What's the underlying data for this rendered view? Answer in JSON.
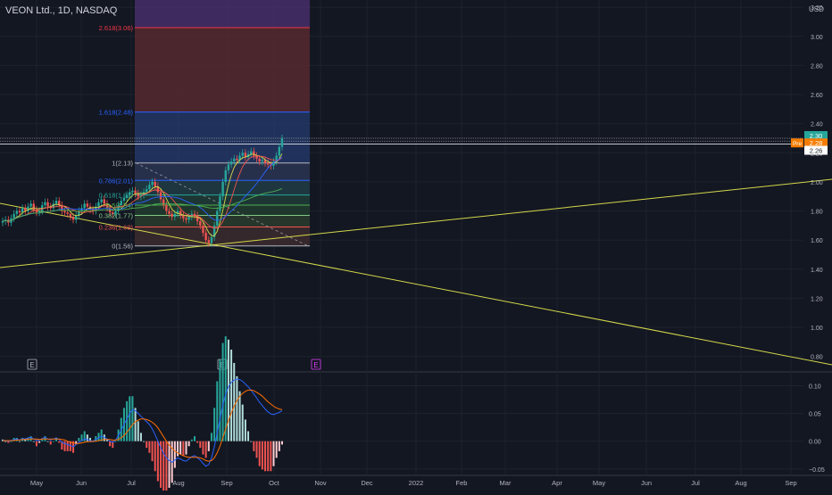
{
  "header": {
    "symbol_title": "VEON Ltd., 1D, NASDAQ",
    "currency": "USD"
  },
  "colors": {
    "background": "#131722",
    "grid": "#1e222d",
    "up": "#26a69a",
    "down": "#ef5350",
    "trendline": "#d4d84a",
    "macd": "#2962ff",
    "signal": "#ff6d00",
    "fib_top_zone": "#4a2f6e",
    "fib_red_zone": "#5a2a30",
    "fib_blue_zone": "#243a6a",
    "pre_badge": "#f57c00"
  },
  "price_axis": {
    "labels": [
      "3.20",
      "3.00",
      "2.80",
      "2.60",
      "2.40",
      "2.20",
      "2.00",
      "1.80",
      "1.60",
      "1.40",
      "1.20",
      "1.00",
      "0.80"
    ],
    "badges": [
      {
        "text": "2.30",
        "color": "#26a69a",
        "text_color": "#ffffff"
      },
      {
        "text": "2.28",
        "color": "#f57c00",
        "text_color": "#ffffff",
        "tag": "Pre"
      },
      {
        "text": "2.26",
        "color": "#ffffff",
        "text_color": "#131722"
      }
    ]
  },
  "macd_axis": {
    "labels": [
      "0.10",
      "0.05",
      "0.00",
      "−0.05"
    ]
  },
  "time_axis": {
    "labels": [
      "May",
      "Jun",
      "Jul",
      "Aug",
      "Sep",
      "Oct",
      "Nov",
      "Dec",
      "2022",
      "Feb",
      "Mar",
      "Apr",
      "May",
      "Jun",
      "Jul",
      "Aug",
      "Sep"
    ]
  },
  "fib_levels": [
    {
      "label": "2.618(3.06)",
      "price": 3.06,
      "color": "#f23645"
    },
    {
      "label": "1.618(2.48)",
      "price": 2.48,
      "color": "#2962ff"
    },
    {
      "label": "1(2.13)",
      "price": 2.13,
      "color": "#b2b5be"
    },
    {
      "label": "0.786(2.01)",
      "price": 2.01,
      "color": "#2962ff"
    },
    {
      "label": "0.618(1.91)",
      "price": 1.91,
      "color": "#26a69a"
    },
    {
      "label": "0.5(1.84)",
      "price": 1.84,
      "color": "#4caf50"
    },
    {
      "label": "0.382(1.77)",
      "price": 1.77,
      "color": "#81c784"
    },
    {
      "label": "0.236(1.69)",
      "price": 1.69,
      "color": "#ef5350"
    },
    {
      "label": "0(1.56)",
      "price": 1.56,
      "color": "#b2b5be"
    }
  ],
  "earnings_markers": [
    {
      "label": "E",
      "month_pos": "Apr",
      "color": "#b2b5be"
    },
    {
      "label": "E",
      "month_pos": "Sep",
      "color": "#b2b5be"
    },
    {
      "label": "E",
      "month_pos": "Oct",
      "color": "#e040fb"
    }
  ],
  "chart_data": {
    "type": "candlestick",
    "price_range": [
      0.7,
      3.25
    ],
    "macd_range": [
      -0.06,
      0.12
    ],
    "closes": [
      1.73,
      1.74,
      1.72,
      1.75,
      1.78,
      1.8,
      1.79,
      1.82,
      1.8,
      1.83,
      1.85,
      1.81,
      1.79,
      1.8,
      1.84,
      1.86,
      1.83,
      1.82,
      1.85,
      1.87,
      1.84,
      1.8,
      1.79,
      1.78,
      1.76,
      1.74,
      1.77,
      1.8,
      1.82,
      1.85,
      1.83,
      1.81,
      1.8,
      1.83,
      1.86,
      1.88,
      1.85,
      1.82,
      1.79,
      1.78,
      1.8,
      1.84,
      1.87,
      1.89,
      1.91,
      1.93,
      1.94,
      1.92,
      1.9,
      1.91,
      1.93,
      1.95,
      1.98,
      2.0,
      1.97,
      1.93,
      1.88,
      1.84,
      1.8,
      1.78,
      1.76,
      1.78,
      1.8,
      1.77,
      1.75,
      1.74,
      1.76,
      1.78,
      1.77,
      1.73,
      1.7,
      1.65,
      1.6,
      1.58,
      1.62,
      1.7,
      1.8,
      1.9,
      2.0,
      2.08,
      2.12,
      2.14,
      2.16,
      2.15,
      2.18,
      2.2,
      2.17,
      2.19,
      2.21,
      2.18,
      2.16,
      2.14,
      2.15,
      2.13,
      2.12,
      2.11,
      2.14,
      2.18,
      2.24,
      2.3
    ],
    "macd": [
      0.002,
      0.001,
      0.0,
      0.001,
      0.003,
      0.004,
      0.002,
      0.005,
      0.004,
      0.006,
      0.007,
      0.004,
      0.001,
      0.002,
      0.005,
      0.007,
      0.004,
      0.002,
      0.004,
      0.006,
      0.003,
      -0.002,
      -0.004,
      -0.006,
      -0.008,
      -0.01,
      -0.006,
      -0.002,
      0.001,
      0.004,
      0.003,
      0.001,
      0.0,
      0.003,
      0.006,
      0.009,
      0.007,
      0.004,
      0.0,
      -0.002,
      0.002,
      0.01,
      0.02,
      0.03,
      0.04,
      0.05,
      0.057,
      0.055,
      0.05,
      0.045,
      0.04,
      0.035,
      0.03,
      0.022,
      0.012,
      0.0,
      -0.012,
      -0.022,
      -0.03,
      -0.035,
      -0.038,
      -0.034,
      -0.03,
      -0.032,
      -0.035,
      -0.036,
      -0.032,
      -0.028,
      -0.026,
      -0.03,
      -0.034,
      -0.04,
      -0.045,
      -0.042,
      -0.03,
      -0.01,
      0.015,
      0.04,
      0.065,
      0.085,
      0.098,
      0.106,
      0.11,
      0.112,
      0.111,
      0.108,
      0.103,
      0.098,
      0.092,
      0.085,
      0.078,
      0.07,
      0.064,
      0.058,
      0.053,
      0.049,
      0.048,
      0.05,
      0.052,
      0.055
    ],
    "signal": [
      0.001,
      0.001,
      0.001,
      0.001,
      0.001,
      0.002,
      0.002,
      0.003,
      0.003,
      0.004,
      0.004,
      0.004,
      0.004,
      0.003,
      0.004,
      0.004,
      0.004,
      0.004,
      0.004,
      0.004,
      0.004,
      0.003,
      0.002,
      0.0,
      -0.002,
      -0.003,
      -0.004,
      -0.004,
      -0.003,
      -0.002,
      -0.001,
      -0.001,
      0.0,
      0.0,
      0.001,
      0.002,
      0.003,
      0.003,
      0.003,
      0.002,
      0.002,
      0.003,
      0.006,
      0.01,
      0.016,
      0.023,
      0.03,
      0.035,
      0.038,
      0.04,
      0.04,
      0.039,
      0.037,
      0.034,
      0.03,
      0.024,
      0.016,
      0.008,
      0.0,
      -0.007,
      -0.013,
      -0.018,
      -0.021,
      -0.024,
      -0.026,
      -0.028,
      -0.029,
      -0.029,
      -0.029,
      -0.029,
      -0.03,
      -0.032,
      -0.035,
      -0.036,
      -0.035,
      -0.03,
      -0.021,
      -0.009,
      0.006,
      0.022,
      0.037,
      0.051,
      0.063,
      0.073,
      0.081,
      0.086,
      0.09,
      0.092,
      0.092,
      0.091,
      0.088,
      0.085,
      0.081,
      0.076,
      0.071,
      0.067,
      0.063,
      0.06,
      0.058,
      0.057
    ]
  }
}
